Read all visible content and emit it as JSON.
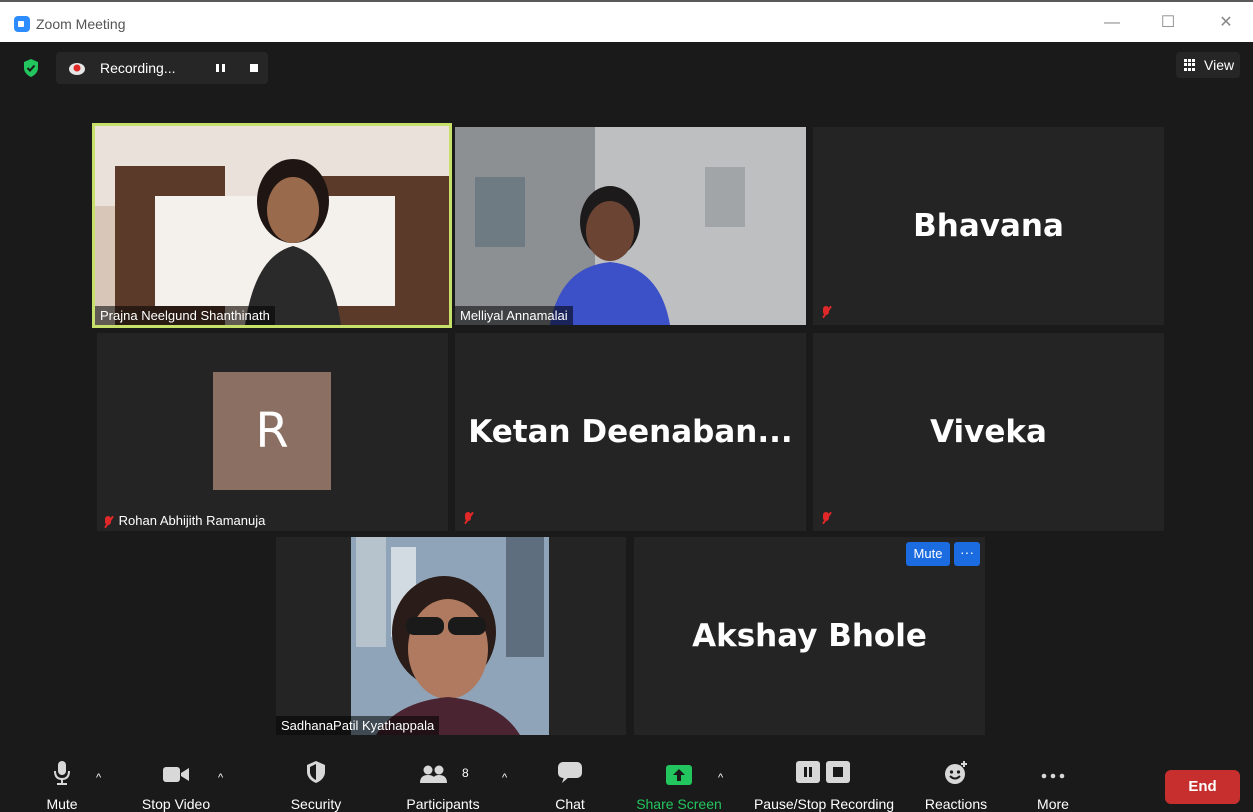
{
  "window": {
    "title": "Zoom Meeting",
    "minimize": "—",
    "maximize": "☐",
    "close": "✕"
  },
  "recording": {
    "label": "Recording..."
  },
  "view": {
    "label": "View"
  },
  "participants_tiles": [
    {
      "name": "Prajna Neelgund Shanthinath",
      "video": true,
      "active_speaker": true
    },
    {
      "name": "Melliyal Annamalai",
      "video": true
    },
    {
      "name": "Bhavana",
      "video": false,
      "muted": true
    },
    {
      "name": "Rohan Abhijith Ramanuja",
      "video": false,
      "muted": true,
      "avatar_letter": "R",
      "avatar_color": "#8c6f63"
    },
    {
      "name": "Ketan  Deenaban...",
      "video": false,
      "muted": true
    },
    {
      "name": "Viveka",
      "video": false,
      "muted": true
    },
    {
      "name": "SadhanaPatil Kyathappala",
      "video": true
    },
    {
      "name": "Akshay Bhole",
      "video": false,
      "hover_actions": {
        "mute": "Mute",
        "more": "···"
      }
    }
  ],
  "toolbar": {
    "mute": "Mute",
    "stop_video": "Stop Video",
    "security": "Security",
    "participants": "Participants",
    "participants_count": "8",
    "chat": "Chat",
    "share_screen": "Share Screen",
    "pause_stop_recording": "Pause/Stop Recording",
    "reactions": "Reactions",
    "more": "More",
    "end": "End"
  },
  "colors": {
    "accent_blue": "#1b6ce0",
    "share_green": "#23c55e",
    "end_red": "#c72f2f",
    "active_speaker_border": "#c7e06a"
  }
}
